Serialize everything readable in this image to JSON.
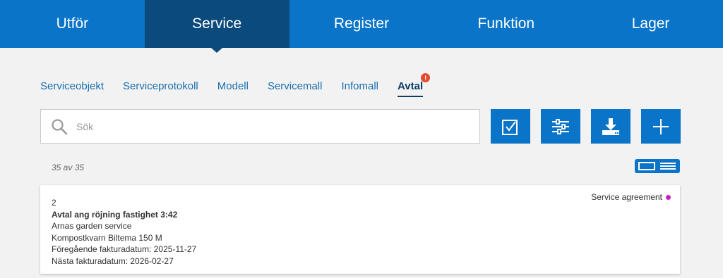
{
  "topnav": {
    "tabs": [
      "Utför",
      "Service",
      "Register",
      "Funktion",
      "Lager"
    ],
    "active_index": 1
  },
  "subtabs": {
    "items": [
      "Serviceobjekt",
      "Serviceprotokoll",
      "Modell",
      "Servicemall",
      "Infomall",
      "Avtal"
    ],
    "active": "Avtal",
    "badge": "!"
  },
  "search": {
    "placeholder": "Sök",
    "icon": "search-icon"
  },
  "actions": {
    "icons": [
      "checkbox-icon",
      "sliders-icon",
      "download-icon",
      "plus-icon"
    ]
  },
  "list": {
    "count_text": "35 av 35",
    "view_modes": [
      "card-view-icon",
      "list-view-icon"
    ]
  },
  "card": {
    "number": "2",
    "title": "Avtal ang röjning fastighet 3:42",
    "customer": "Arnas garden service",
    "object": "Kompostkvarn Biltema 150 M",
    "prev_invoice": "Föregående fakturadatum: 2025-11-27",
    "next_invoice": "Nästa fakturadatum: 2026-02-27",
    "type_label": "Service agreement",
    "type_color": "#c81ec8"
  },
  "colors": {
    "primary": "#0a74c9",
    "primary_dark": "#0b4a7c",
    "badge": "#e34b2c"
  }
}
